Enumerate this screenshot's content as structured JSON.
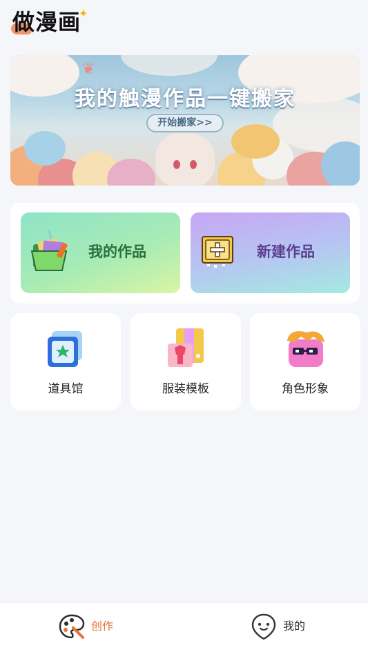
{
  "header": {
    "app_title": "做漫画"
  },
  "banner": {
    "title": "我的触漫作品一键搬家",
    "cta_label": "开始搬家>>"
  },
  "works": {
    "my_works_label": "我的作品",
    "new_work_label": "新建作品"
  },
  "tools": [
    {
      "label": "道具馆",
      "icon": "star-frame-icon"
    },
    {
      "label": "服装模板",
      "icon": "costume-icon"
    },
    {
      "label": "角色形象",
      "icon": "character-icon"
    }
  ],
  "bottom_nav": {
    "items": [
      {
        "label": "创作",
        "icon": "palette-icon",
        "active": true
      },
      {
        "label": "我的",
        "icon": "face-pin-icon",
        "active": false
      }
    ]
  },
  "colors": {
    "accent": "#e9703f",
    "background": "#f5f6fa"
  }
}
